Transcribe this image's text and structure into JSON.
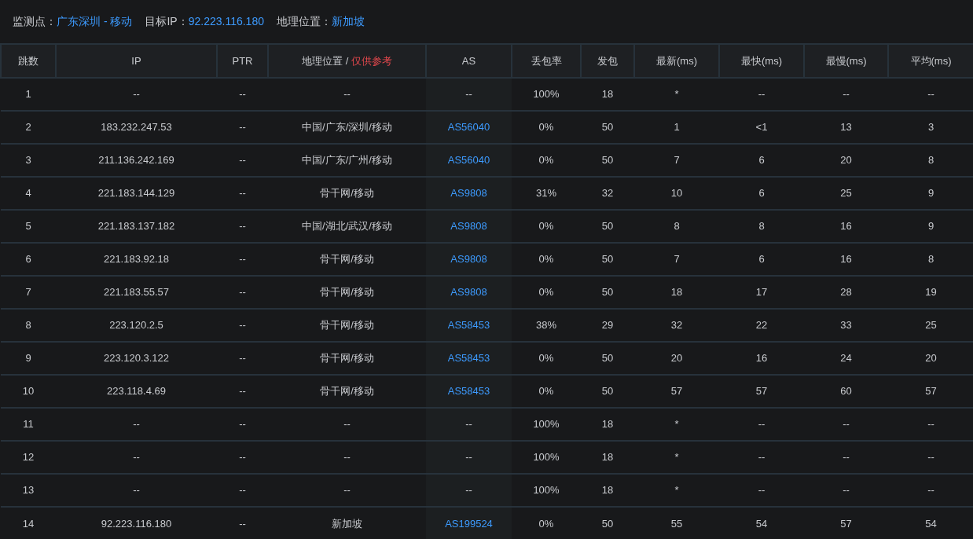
{
  "summary": [
    {
      "label": "监测点：",
      "value": "广东深圳 - 移动"
    },
    {
      "label": "目标IP：",
      "value": "92.223.116.180"
    },
    {
      "label": "地理位置：",
      "value": "新加坡"
    }
  ],
  "columns": [
    {
      "label": "跳数"
    },
    {
      "label": "IP"
    },
    {
      "label": "PTR"
    },
    {
      "label": "地理位置 / ",
      "note": "仅供参考"
    },
    {
      "label": "AS"
    },
    {
      "label": "丢包率"
    },
    {
      "label": "发包"
    },
    {
      "label": "最新(ms)"
    },
    {
      "label": "最快(ms)"
    },
    {
      "label": "最慢(ms)"
    },
    {
      "label": "平均(ms)"
    }
  ],
  "rows": [
    {
      "hop": "1",
      "ip": "--",
      "ptr": "--",
      "geo": "--",
      "as": {
        "text": "--",
        "link": false
      },
      "loss": "100%",
      "sent": "18",
      "last": "*",
      "best": "--",
      "worst": "--",
      "avg": "--"
    },
    {
      "hop": "2",
      "ip": "183.232.247.53",
      "ptr": "--",
      "geo": "中国/广东/深圳/移动",
      "as": {
        "text": "AS56040",
        "link": true
      },
      "loss": "0%",
      "sent": "50",
      "last": "1",
      "best": "<1",
      "worst": "13",
      "avg": "3"
    },
    {
      "hop": "3",
      "ip": "211.136.242.169",
      "ptr": "--",
      "geo": "中国/广东/广州/移动",
      "as": {
        "text": "AS56040",
        "link": true
      },
      "loss": "0%",
      "sent": "50",
      "last": "7",
      "best": "6",
      "worst": "20",
      "avg": "8"
    },
    {
      "hop": "4",
      "ip": "221.183.144.129",
      "ptr": "--",
      "geo": "骨干网/移动",
      "as": {
        "text": "AS9808",
        "link": true
      },
      "loss": "31%",
      "sent": "32",
      "last": "10",
      "best": "6",
      "worst": "25",
      "avg": "9"
    },
    {
      "hop": "5",
      "ip": "221.183.137.182",
      "ptr": "--",
      "geo": "中国/湖北/武汉/移动",
      "as": {
        "text": "AS9808",
        "link": true
      },
      "loss": "0%",
      "sent": "50",
      "last": "8",
      "best": "8",
      "worst": "16",
      "avg": "9"
    },
    {
      "hop": "6",
      "ip": "221.183.92.18",
      "ptr": "--",
      "geo": "骨干网/移动",
      "as": {
        "text": "AS9808",
        "link": true
      },
      "loss": "0%",
      "sent": "50",
      "last": "7",
      "best": "6",
      "worst": "16",
      "avg": "8"
    },
    {
      "hop": "7",
      "ip": "221.183.55.57",
      "ptr": "--",
      "geo": "骨干网/移动",
      "as": {
        "text": "AS9808",
        "link": true
      },
      "loss": "0%",
      "sent": "50",
      "last": "18",
      "best": "17",
      "worst": "28",
      "avg": "19"
    },
    {
      "hop": "8",
      "ip": "223.120.2.5",
      "ptr": "--",
      "geo": "骨干网/移动",
      "as": {
        "text": "AS58453",
        "link": true
      },
      "loss": "38%",
      "sent": "29",
      "last": "32",
      "best": "22",
      "worst": "33",
      "avg": "25"
    },
    {
      "hop": "9",
      "ip": "223.120.3.122",
      "ptr": "--",
      "geo": "骨干网/移动",
      "as": {
        "text": "AS58453",
        "link": true
      },
      "loss": "0%",
      "sent": "50",
      "last": "20",
      "best": "16",
      "worst": "24",
      "avg": "20"
    },
    {
      "hop": "10",
      "ip": "223.118.4.69",
      "ptr": "--",
      "geo": "骨干网/移动",
      "as": {
        "text": "AS58453",
        "link": true
      },
      "loss": "0%",
      "sent": "50",
      "last": "57",
      "best": "57",
      "worst": "60",
      "avg": "57"
    },
    {
      "hop": "11",
      "ip": "--",
      "ptr": "--",
      "geo": "--",
      "as": {
        "text": "--",
        "link": false
      },
      "loss": "100%",
      "sent": "18",
      "last": "*",
      "best": "--",
      "worst": "--",
      "avg": "--"
    },
    {
      "hop": "12",
      "ip": "--",
      "ptr": "--",
      "geo": "--",
      "as": {
        "text": "--",
        "link": false
      },
      "loss": "100%",
      "sent": "18",
      "last": "*",
      "best": "--",
      "worst": "--",
      "avg": "--"
    },
    {
      "hop": "13",
      "ip": "--",
      "ptr": "--",
      "geo": "--",
      "as": {
        "text": "--",
        "link": false
      },
      "loss": "100%",
      "sent": "18",
      "last": "*",
      "best": "--",
      "worst": "--",
      "avg": "--"
    },
    {
      "hop": "14",
      "ip": "92.223.116.180",
      "ptr": "--",
      "geo": "新加坡",
      "as": {
        "text": "AS199524",
        "link": true
      },
      "loss": "0%",
      "sent": "50",
      "last": "55",
      "best": "54",
      "worst": "57",
      "avg": "54"
    }
  ]
}
